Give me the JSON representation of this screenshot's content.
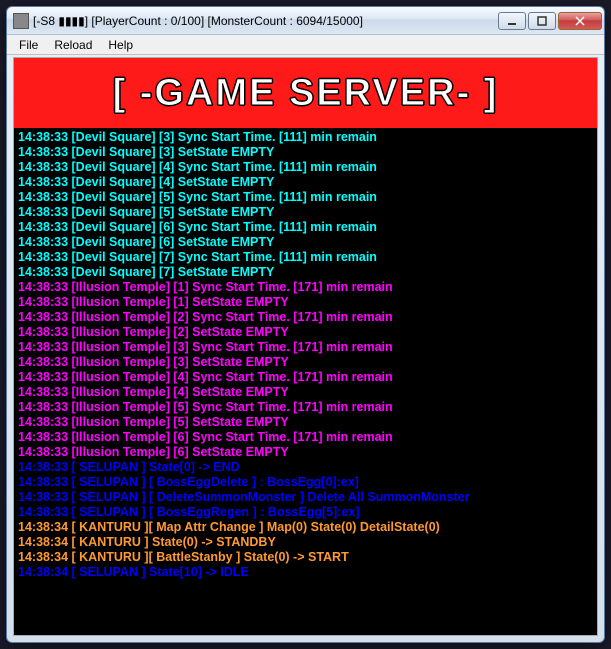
{
  "window": {
    "title": "[-S8 ▮▮▮▮] [PlayerCount : 0/100] [MonsterCount : 6094/15000]"
  },
  "menu": {
    "file": "File",
    "reload": "Reload",
    "help": "Help"
  },
  "banner": {
    "text": "[ -GAME SERVER- ]"
  },
  "log": [
    {
      "c": "cyan",
      "t": "14:38:33 [Devil Square] [3] Sync Start Time. [111] min remain"
    },
    {
      "c": "cyan",
      "t": "14:38:33 [Devil Square] [3] SetState EMPTY"
    },
    {
      "c": "cyan",
      "t": "14:38:33 [Devil Square] [4] Sync Start Time. [111] min remain"
    },
    {
      "c": "cyan",
      "t": "14:38:33 [Devil Square] [4] SetState EMPTY"
    },
    {
      "c": "cyan",
      "t": "14:38:33 [Devil Square] [5] Sync Start Time. [111] min remain"
    },
    {
      "c": "cyan",
      "t": "14:38:33 [Devil Square] [5] SetState EMPTY"
    },
    {
      "c": "cyan",
      "t": "14:38:33 [Devil Square] [6] Sync Start Time. [111] min remain"
    },
    {
      "c": "cyan",
      "t": "14:38:33 [Devil Square] [6] SetState EMPTY"
    },
    {
      "c": "cyan",
      "t": "14:38:33 [Devil Square] [7] Sync Start Time. [111] min remain"
    },
    {
      "c": "cyan",
      "t": "14:38:33 [Devil Square] [7] SetState EMPTY"
    },
    {
      "c": "magenta",
      "t": "14:38:33 [Illusion Temple] [1] Sync Start Time. [171] min remain"
    },
    {
      "c": "magenta",
      "t": "14:38:33 [Illusion Temple] [1] SetState EMPTY"
    },
    {
      "c": "magenta",
      "t": "14:38:33 [Illusion Temple] [2] Sync Start Time. [171] min remain"
    },
    {
      "c": "magenta",
      "t": "14:38:33 [Illusion Temple] [2] SetState EMPTY"
    },
    {
      "c": "magenta",
      "t": "14:38:33 [Illusion Temple] [3] Sync Start Time. [171] min remain"
    },
    {
      "c": "magenta",
      "t": "14:38:33 [Illusion Temple] [3] SetState EMPTY"
    },
    {
      "c": "magenta",
      "t": "14:38:33 [Illusion Temple] [4] Sync Start Time. [171] min remain"
    },
    {
      "c": "magenta",
      "t": "14:38:33 [Illusion Temple] [4] SetState EMPTY"
    },
    {
      "c": "magenta",
      "t": "14:38:33 [Illusion Temple] [5] Sync Start Time. [171] min remain"
    },
    {
      "c": "magenta",
      "t": "14:38:33 [Illusion Temple] [5] SetState EMPTY"
    },
    {
      "c": "magenta",
      "t": "14:38:33 [Illusion Temple] [6] Sync Start Time. [171] min remain"
    },
    {
      "c": "magenta",
      "t": "14:38:33 [Illusion Temple] [6] SetState EMPTY"
    },
    {
      "c": "blue",
      "t": "14:38:33 [ SELUPAN ] State[0] -> END"
    },
    {
      "c": "blue",
      "t": "14:38:33 [ SELUPAN ] [ BossEggDelete ] : BossEgg[0]:ex]"
    },
    {
      "c": "blue",
      "t": "14:38:33 [ SELUPAN ] [ DeleteSummonMonster ] Delete All SummonMonster"
    },
    {
      "c": "blue",
      "t": "14:38:33 [ SELUPAN ] [ BossEggRegen ] : BossEgg[5]:ex]"
    },
    {
      "c": "orange",
      "t": "14:38:34 [ KANTURU ][ Map Attr Change ] Map(0) State(0) DetailState(0)"
    },
    {
      "c": "orange",
      "t": "14:38:34 [ KANTURU ] State(0) -> STANDBY"
    },
    {
      "c": "orange",
      "t": "14:38:34 [ KANTURU ][ BattleStanby ] State(0) -> START"
    },
    {
      "c": "blue",
      "t": "14:38:34 [ SELUPAN ] State[10] -> IDLE"
    }
  ]
}
